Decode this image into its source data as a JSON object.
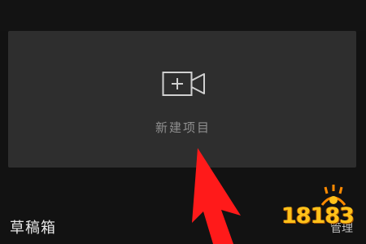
{
  "new_project": {
    "label": "新建项目",
    "icon": "video-camera-plus-icon"
  },
  "drafts": {
    "title": "草稿箱",
    "manage_label": "管理"
  },
  "watermark": {
    "text": "18183"
  },
  "colors": {
    "background": "#121212",
    "card": "#2e2e2e",
    "annotation_arrow": "#ff1a1a",
    "watermark": "#ffc21a"
  }
}
